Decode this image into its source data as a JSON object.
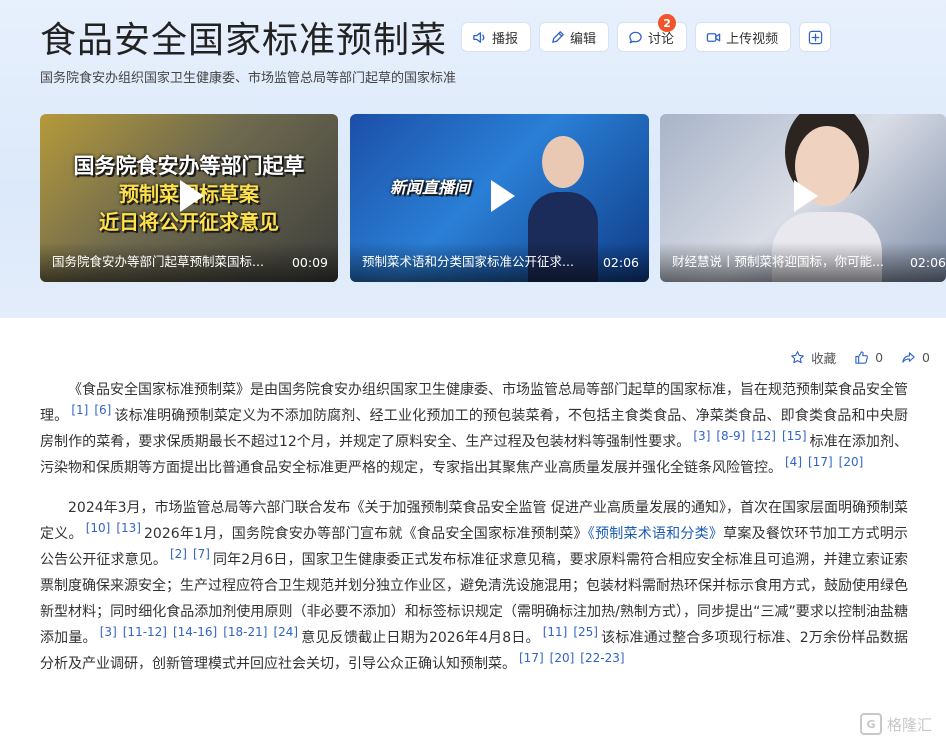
{
  "header": {
    "title": "食品安全国家标准预制菜",
    "subtitle": "国务院食安办组织国家卫生健康委、市场监管总局等部门起草的国家标准",
    "actions": [
      {
        "label": "播报"
      },
      {
        "label": "编辑"
      },
      {
        "label": "讨论",
        "badge": "2"
      },
      {
        "label": "上传视频"
      }
    ]
  },
  "videos": [
    {
      "overlay_lines": [
        "国务院食安办等部门起草",
        "预制菜国标草案",
        "近日将公开征求意见"
      ],
      "caption": "国务院食安办等部门起草预制菜国标...",
      "duration": "00:09"
    },
    {
      "overlay_lines": [
        "新闻直播间"
      ],
      "caption": "预制菜术语和分类国家标准公开征求...",
      "duration": "02:06"
    },
    {
      "overlay_lines": [],
      "caption": "财经慧说丨预制菜将迎国标，你可能...",
      "duration": "02:06"
    }
  ],
  "tools": {
    "favorite": "收藏",
    "like_count": "0",
    "share_count": "0"
  },
  "content": {
    "p1": {
      "s1": "《食品安全国家标准预制菜》是由国务院食安办组织国家卫生健康委、市场监管总局等部门起草的国家标准，旨在规范预制菜食品安全管理。",
      "r1": [
        "[1]",
        "[6]"
      ],
      "s2": "该标准明确预制菜定义为不添加防腐剂、经工业化预加工的预包装菜肴，不包括主食类食品、净菜类食品、即食类食品和中央厨房制作的菜肴，要求保质期最长不超过12个月，并规定了原料安全、生产过程及包装材料等强制性要求。",
      "r2": [
        "[3]",
        "[8-9]",
        "[12]",
        "[15]"
      ],
      "s3": "标准在添加剂、污染物和保质期等方面提出比普通食品安全标准更严格的规定，专家指出其聚焦产业高质量发展并强化全链条风险管控。",
      "r3": [
        "[4]",
        "[17]",
        "[20]"
      ]
    },
    "p2": {
      "s1": "2024年3月，市场监管总局等六部门联合发布《关于加强预制菜食品安全监管 促进产业高质量发展的通知》，首次在国家层面明确预制菜定义。",
      "r1": [
        "[10]",
        "[13]"
      ],
      "s2a": "2026年1月，国务院食安办等部门宣布就《食品安全国家标准预制菜》",
      "link": "《预制菜术语和分类》",
      "s2b": "草案及餐饮环节加工方式明示公告公开征求意见。",
      "r2": [
        "[2]",
        "[7]"
      ],
      "s3": "同年2月6日，国家卫生健康委正式发布标准征求意见稿，要求原料需符合相应安全标准且可追溯，并建立索证索票制度确保来源安全；生产过程应符合卫生规范并划分独立作业区，避免清洗设施混用；包装材料需耐热环保并标示食用方式，鼓励使用绿色新型材料；同时细化食品添加剂使用原则（非必要不添加）和标签标识规定（需明确标注加热/熟制方式），同步提出“三减”要求以控制油盐糖添加量。",
      "r3": [
        "[3]",
        "[11-12]",
        "[14-16]",
        "[18-21]",
        "[24]"
      ],
      "s4": "意见反馈截止日期为2026年4月8日。",
      "r4": [
        "[11]",
        "[25]"
      ],
      "s5": "该标准通过整合多项现行标准、2万余份样品数据分析及产业调研，创新管理模式并回应社会关切，引导公众正确认知预制菜。",
      "r5": [
        "[17]",
        "[20]",
        "[22-23]"
      ]
    }
  },
  "watermark": "格隆汇",
  "colors": {
    "accent": "#3264c8",
    "badge": "#f2552c",
    "link": "#1a5cb3"
  }
}
